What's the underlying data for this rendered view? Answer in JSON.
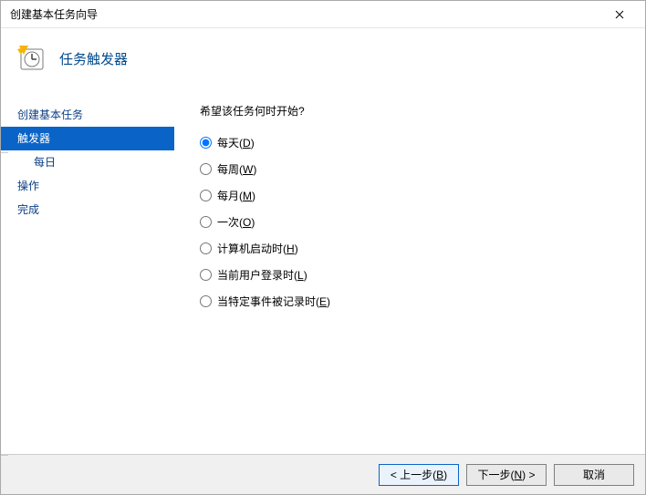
{
  "window": {
    "title": "创建基本任务向导"
  },
  "header": {
    "title": "任务触发器"
  },
  "sidebar": {
    "items": [
      {
        "label": "创建基本任务",
        "active": false,
        "sub": false
      },
      {
        "label": "触发器",
        "active": true,
        "sub": false
      },
      {
        "label": "每日",
        "active": false,
        "sub": true
      },
      {
        "label": "操作",
        "active": false,
        "sub": false
      },
      {
        "label": "完成",
        "active": false,
        "sub": false
      }
    ]
  },
  "main": {
    "prompt": "希望该任务何时开始?",
    "options": [
      {
        "label": "每天",
        "hotkey": "D",
        "checked": true
      },
      {
        "label": "每周",
        "hotkey": "W",
        "checked": false
      },
      {
        "label": "每月",
        "hotkey": "M",
        "checked": false
      },
      {
        "label": "一次",
        "hotkey": "O",
        "checked": false
      },
      {
        "label": "计算机启动时",
        "hotkey": "H",
        "checked": false
      },
      {
        "label": "当前用户登录时",
        "hotkey": "L",
        "checked": false
      },
      {
        "label": "当特定事件被记录时",
        "hotkey": "E",
        "checked": false
      }
    ]
  },
  "footer": {
    "back": {
      "prefix": "< 上一步(",
      "hotkey": "B",
      "suffix": ")"
    },
    "next": {
      "prefix": "下一步(",
      "hotkey": "N",
      "suffix": ") >"
    },
    "cancel": {
      "label": "取消"
    }
  }
}
